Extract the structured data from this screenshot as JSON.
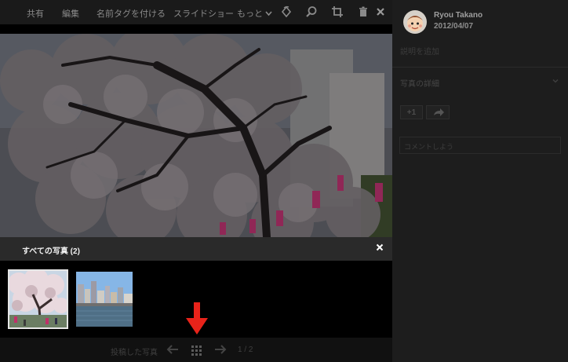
{
  "toolbar": {
    "share": "共有",
    "edit": "編集",
    "tag_names": "名前タグを付ける",
    "slideshow": "スライドショー",
    "more": "もっと"
  },
  "album": {
    "title": "すべての写真 (2)"
  },
  "navigation": {
    "posted_photos": "投稿した写真",
    "counter": "1 / 2"
  },
  "sidebar": {
    "author_name": "Ryou Takano",
    "post_date": "2012/04/07",
    "add_description": "説明を追加",
    "photo_details": "写真の詳細",
    "plus_one": "+1",
    "comment_placeholder": "コメントしよう"
  },
  "colors": {
    "arrow_red": "#e8231a",
    "panel_bg": "#1d1d1d"
  }
}
